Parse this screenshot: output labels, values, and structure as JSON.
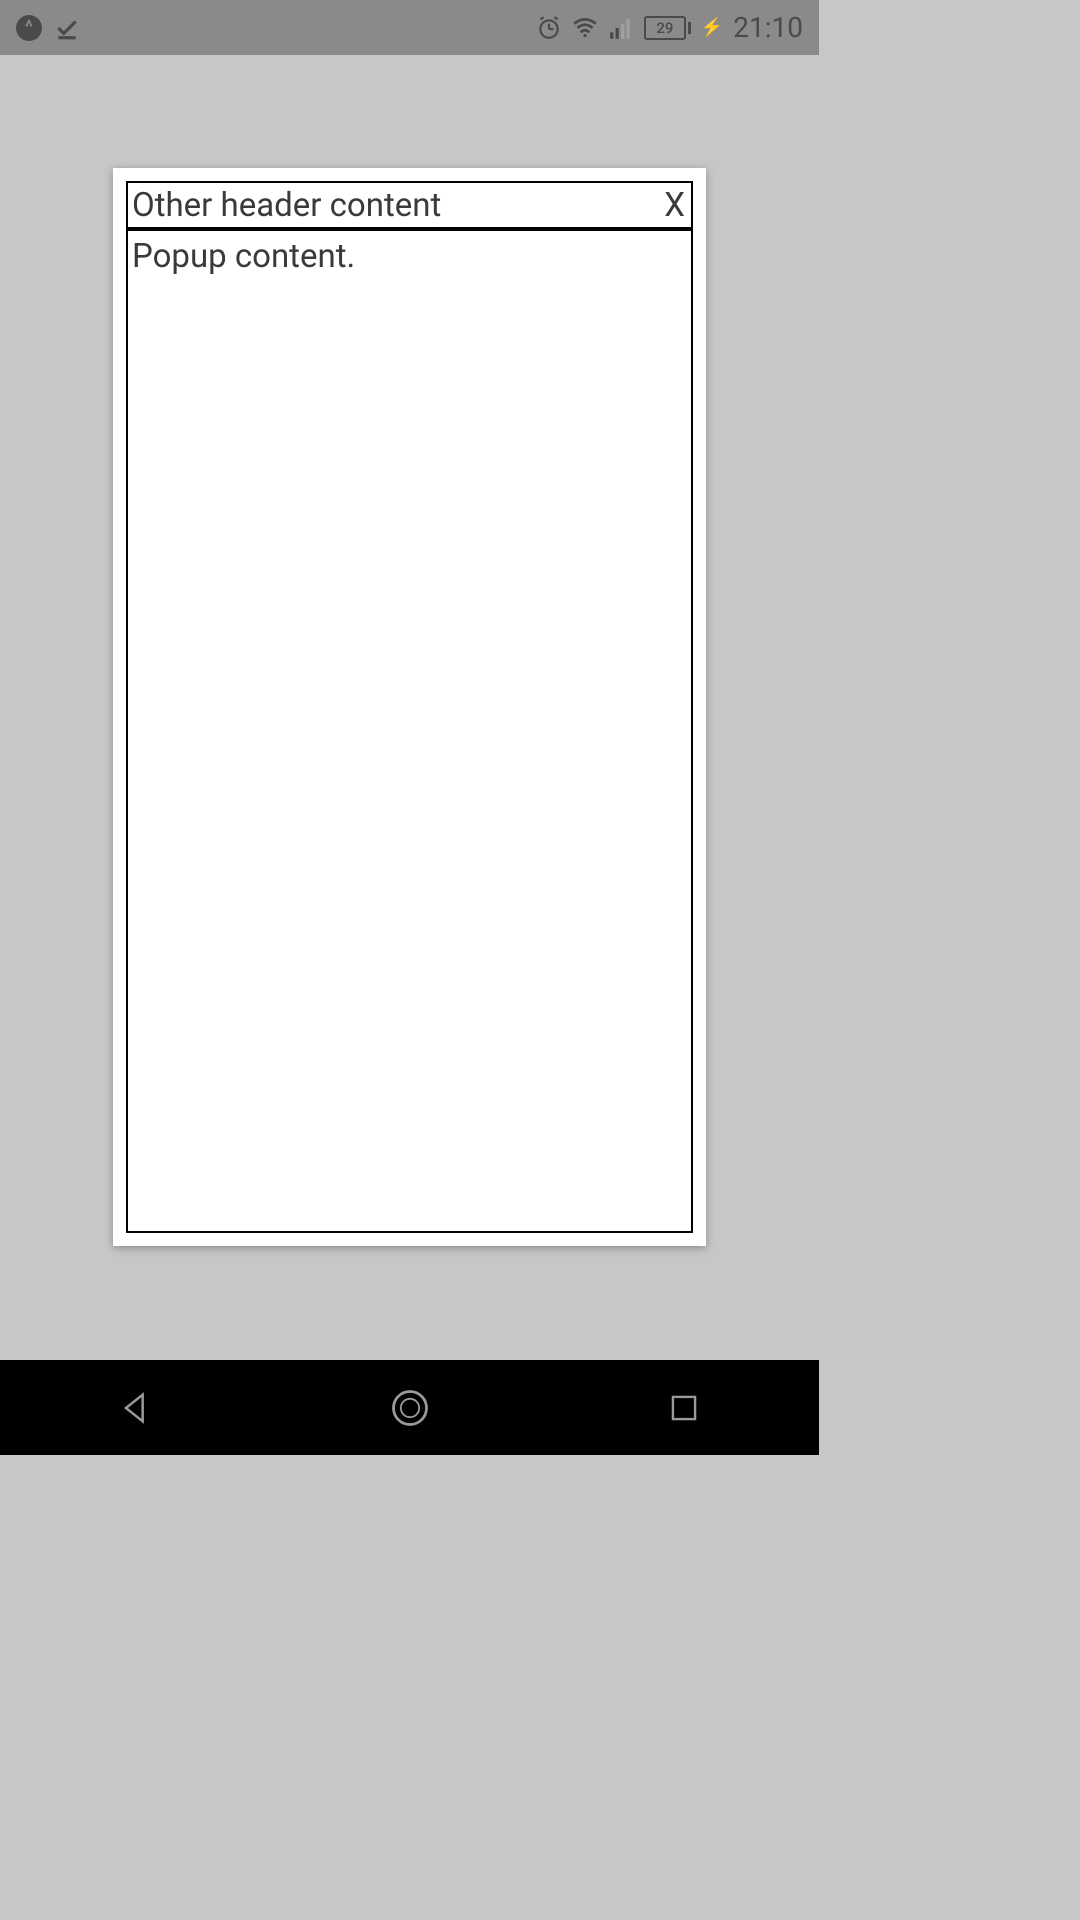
{
  "status_bar": {
    "battery_level": "29",
    "time": "21:10"
  },
  "popup": {
    "header_title": "Other header content",
    "close_label": "X",
    "body_text": "Popup content."
  }
}
